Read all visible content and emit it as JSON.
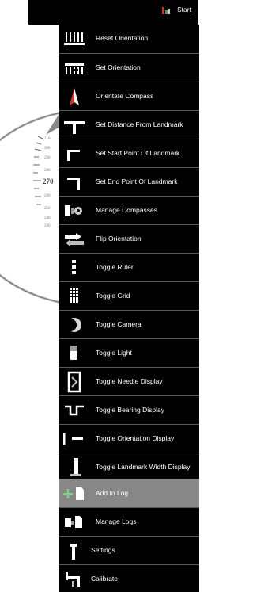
{
  "header": {
    "start_label": "Start",
    "status_icon": "signal-bars-icon"
  },
  "compass_dial": {
    "labels": [
      "310",
      "300",
      "290",
      "280",
      "270",
      "260",
      "250",
      "240",
      "230"
    ],
    "major_label": "270"
  },
  "menu": {
    "items": [
      {
        "label": "Reset Orientation",
        "icon": "reset-orientation-icon"
      },
      {
        "label": "Set Orientation",
        "icon": "set-orientation-icon"
      },
      {
        "label": "Orientate Compass",
        "icon": "orientate-compass-icon"
      },
      {
        "label": "Set Distance From Landmark",
        "icon": "distance-landmark-icon"
      },
      {
        "label": "Set Start Point Of Landmark",
        "icon": "start-point-icon"
      },
      {
        "label": "Set End Point Of Landmark",
        "icon": "end-point-icon"
      },
      {
        "label": "Manage Compasses",
        "icon": "manage-compasses-icon"
      },
      {
        "label": "Flip Orientation",
        "icon": "flip-orientation-icon"
      },
      {
        "label": "Toggle Ruler",
        "icon": "ruler-icon"
      },
      {
        "label": "Toggle Grid",
        "icon": "grid-icon"
      },
      {
        "label": "Toggle Camera",
        "icon": "camera-moon-icon"
      },
      {
        "label": "Toggle Light",
        "icon": "light-icon"
      },
      {
        "label": "Toggle Needle Display",
        "icon": "needle-display-icon"
      },
      {
        "label": "Toggle Bearing Display",
        "icon": "bearing-display-icon"
      },
      {
        "label": "Toggle Orientation Display",
        "icon": "orientation-display-icon"
      },
      {
        "label": "Toggle Landmark Width Display",
        "icon": "landmark-width-icon"
      },
      {
        "label": "Add to Log",
        "icon": "add-log-icon",
        "active": true
      },
      {
        "label": "Manage Logs",
        "icon": "manage-logs-icon"
      },
      {
        "label": "Settings",
        "icon": "settings-icon"
      },
      {
        "label": "Calibrate",
        "icon": "calibrate-icon"
      }
    ]
  }
}
